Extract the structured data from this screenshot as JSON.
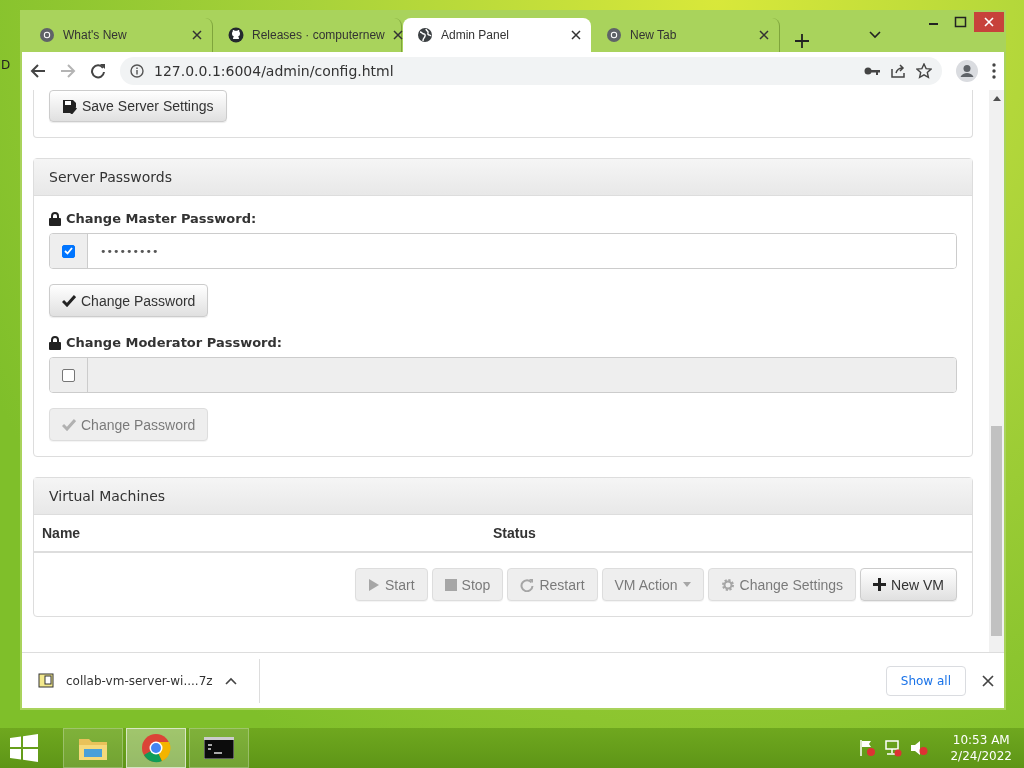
{
  "desktop": {
    "icon_label": "D"
  },
  "browser": {
    "tabs": [
      {
        "label": "What's New",
        "kind": "chrome",
        "selected": false
      },
      {
        "label": "Releases · computernew",
        "kind": "github",
        "selected": false
      },
      {
        "label": "Admin Panel",
        "kind": "globe",
        "selected": true
      },
      {
        "label": "New Tab",
        "kind": "chrome",
        "selected": false
      }
    ],
    "forward_disabled": true,
    "address": "127.0.0.1:6004/admin/config.html"
  },
  "page": {
    "save_button": "Save Server Settings",
    "passwords_panel": {
      "title": "Server Passwords",
      "fields": [
        {
          "label": "Change Master Password:",
          "checked": true,
          "value": "•••••••••",
          "button": "Change Password",
          "button_disabled": false
        },
        {
          "label": "Change Moderator Password:",
          "checked": false,
          "button": "Change Password",
          "button_disabled": true
        }
      ]
    },
    "vm_panel": {
      "title": "Virtual Machines",
      "columns": [
        "Name",
        "Status"
      ],
      "buttons": [
        {
          "label": "Start",
          "kind": "play",
          "disabled": true
        },
        {
          "label": "Stop",
          "kind": "stop",
          "disabled": true
        },
        {
          "label": "Restart",
          "kind": "restart",
          "disabled": true
        },
        {
          "label": "VM Action",
          "kind": "dropdown",
          "disabled": true
        },
        {
          "label": "Change Settings",
          "kind": "gear",
          "disabled": true
        },
        {
          "label": "New VM",
          "kind": "plus",
          "disabled": false
        }
      ]
    }
  },
  "downloads": {
    "file": "collab-vm-server-wi....7z",
    "button": "Show all"
  },
  "taskbar": {
    "apps": [
      {
        "kind": "explorer",
        "selected": false
      },
      {
        "kind": "chrome",
        "selected": true
      },
      {
        "kind": "terminal",
        "selected": false
      }
    ],
    "time": "10:53 AM",
    "date": "2/24/2022"
  }
}
